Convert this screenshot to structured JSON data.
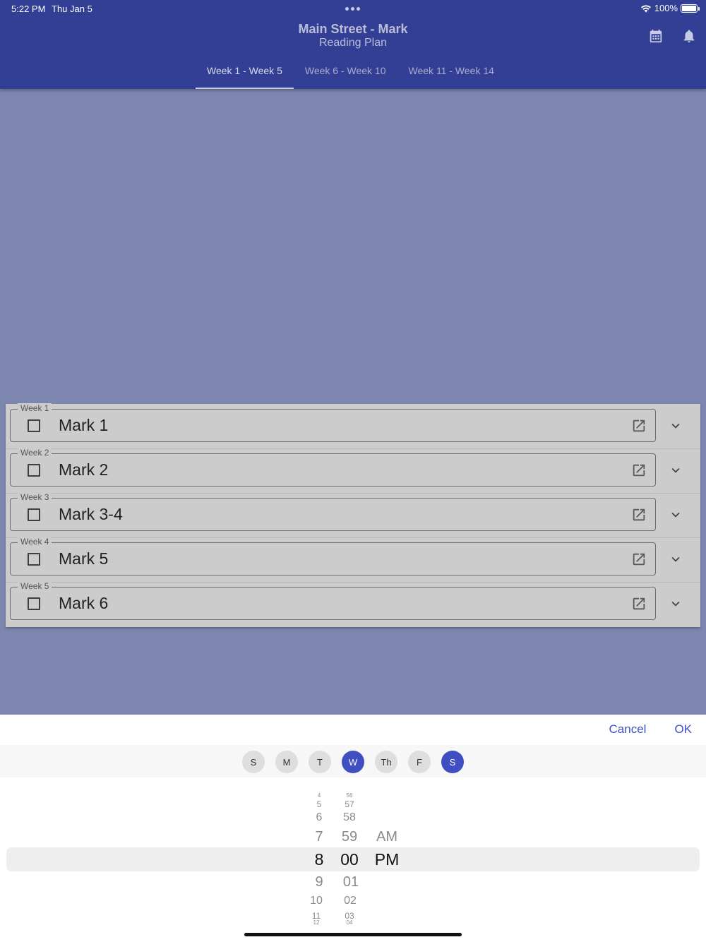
{
  "status_bar": {
    "time": "5:22 PM",
    "date": "Thu Jan 5",
    "battery": "100%"
  },
  "header": {
    "title": "Main Street - Mark",
    "subtitle": "Reading Plan"
  },
  "icons": {
    "calendar": "calendar-icon",
    "notifications": "bell-icon"
  },
  "tabs": [
    {
      "label": "Week 1 - Week 5",
      "active": true
    },
    {
      "label": "Week 6 - Week 10",
      "active": false
    },
    {
      "label": "Week 11 - Week 14",
      "active": false
    }
  ],
  "readings": [
    {
      "week": "Week 1",
      "passage": "Mark 1",
      "checked": false
    },
    {
      "week": "Week 2",
      "passage": "Mark 2",
      "checked": false
    },
    {
      "week": "Week 3",
      "passage": "Mark 3-4",
      "checked": false
    },
    {
      "week": "Week 4",
      "passage": "Mark 5",
      "checked": false
    },
    {
      "week": "Week 5",
      "passage": "Mark 6",
      "checked": false
    }
  ],
  "sheet": {
    "cancel_label": "Cancel",
    "ok_label": "OK",
    "days": [
      {
        "label": "S",
        "selected": false
      },
      {
        "label": "M",
        "selected": false
      },
      {
        "label": "T",
        "selected": false
      },
      {
        "label": "W",
        "selected": true
      },
      {
        "label": "Th",
        "selected": false
      },
      {
        "label": "F",
        "selected": false
      },
      {
        "label": "S",
        "selected": true
      }
    ],
    "hours": [
      "4",
      "5",
      "6",
      "7",
      "8",
      "9",
      "10",
      "11",
      "12"
    ],
    "minutes": [
      "56",
      "57",
      "58",
      "59",
      "00",
      "01",
      "02",
      "03",
      "04"
    ],
    "periods": [
      "AM",
      "PM"
    ],
    "selected_hour": "8",
    "selected_minute": "00",
    "selected_period": "PM"
  },
  "colors": {
    "primary": "#333f94",
    "accent": "#3f4ec1",
    "scrim": "#7d86ae",
    "card": "#cccccc"
  }
}
